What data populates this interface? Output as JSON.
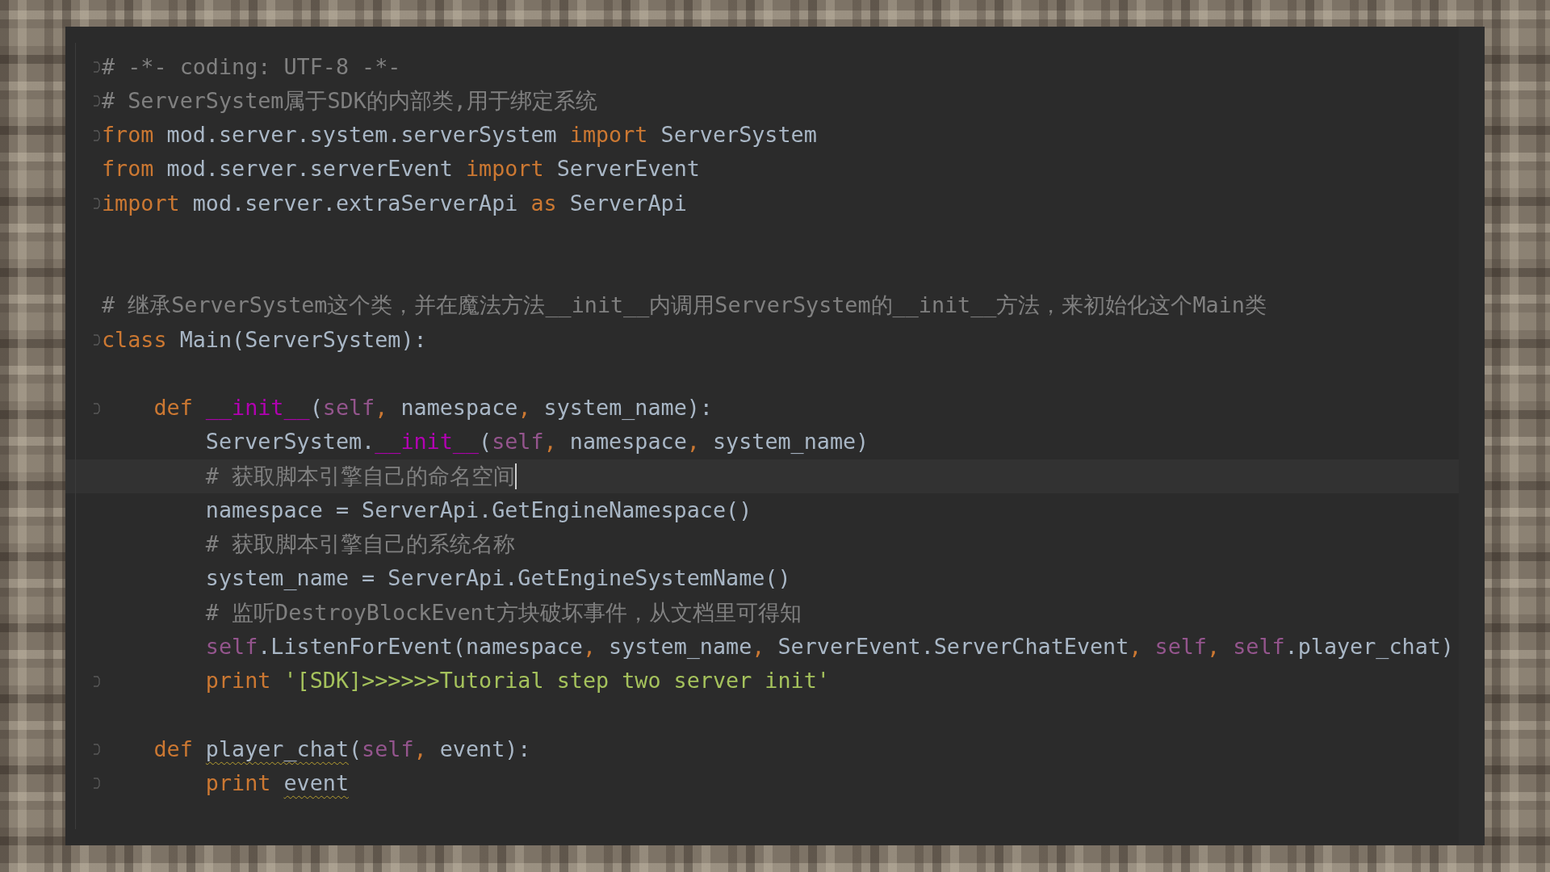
{
  "editor": {
    "lines": [
      {
        "kind": "code",
        "fold": true,
        "current": false,
        "tokens": [
          {
            "t": "# -*- coding: UTF-8 -*-",
            "kind": "comment"
          }
        ]
      },
      {
        "kind": "code",
        "fold": true,
        "current": false,
        "tokens": [
          {
            "t": "# ServerSystem属于SDK的内部类,用于绑定系统",
            "kind": "comment"
          }
        ]
      },
      {
        "kind": "code",
        "fold": true,
        "current": false,
        "tokens": [
          {
            "t": "from",
            "kind": "keyword"
          },
          {
            "t": " mod.server.system.serverSystem ",
            "kind": "plain"
          },
          {
            "t": "import",
            "kind": "keyword"
          },
          {
            "t": " ServerSystem",
            "kind": "plain"
          }
        ]
      },
      {
        "kind": "code",
        "fold": false,
        "current": false,
        "tokens": [
          {
            "t": "from",
            "kind": "keyword"
          },
          {
            "t": " mod.server.serverEvent ",
            "kind": "plain"
          },
          {
            "t": "import",
            "kind": "keyword"
          },
          {
            "t": " ServerEvent",
            "kind": "plain"
          }
        ]
      },
      {
        "kind": "code",
        "fold": true,
        "current": false,
        "tokens": [
          {
            "t": "import",
            "kind": "keyword"
          },
          {
            "t": " mod.server.extraServerApi ",
            "kind": "plain"
          },
          {
            "t": "as",
            "kind": "keyword"
          },
          {
            "t": " ServerApi",
            "kind": "plain"
          }
        ]
      },
      {
        "kind": "blank"
      },
      {
        "kind": "blank"
      },
      {
        "kind": "code",
        "fold": false,
        "current": false,
        "tokens": [
          {
            "t": "# 继承ServerSystem这个类，并在魔法方法__init__内调用ServerSystem的__init__方法，来初始化这个Main类",
            "kind": "comment"
          }
        ]
      },
      {
        "kind": "code",
        "fold": true,
        "current": false,
        "tokens": [
          {
            "t": "class",
            "kind": "keyword"
          },
          {
            "t": " Main(ServerSystem):",
            "kind": "plain"
          }
        ]
      },
      {
        "kind": "blank"
      },
      {
        "kind": "code",
        "fold": true,
        "current": false,
        "tokens": [
          {
            "t": "    def ",
            "kind": "keyword"
          },
          {
            "t": "__init__",
            "kind": "magic"
          },
          {
            "t": "(",
            "kind": "plain"
          },
          {
            "t": "self",
            "kind": "self"
          },
          {
            "t": ",",
            "kind": "keyword"
          },
          {
            "t": " namespace",
            "kind": "plain"
          },
          {
            "t": ",",
            "kind": "keyword"
          },
          {
            "t": " system_name):",
            "kind": "plain"
          }
        ]
      },
      {
        "kind": "code",
        "fold": false,
        "current": false,
        "tokens": [
          {
            "t": "        ServerSystem.",
            "kind": "plain"
          },
          {
            "t": "__init__",
            "kind": "magic"
          },
          {
            "t": "(",
            "kind": "plain"
          },
          {
            "t": "self",
            "kind": "self"
          },
          {
            "t": ",",
            "kind": "keyword"
          },
          {
            "t": " namespace",
            "kind": "plain"
          },
          {
            "t": ",",
            "kind": "keyword"
          },
          {
            "t": " system_name)",
            "kind": "plain"
          }
        ]
      },
      {
        "kind": "code",
        "fold": false,
        "current": true,
        "tokens": [
          {
            "t": "        # 获取脚本引擎自己的命名空间",
            "kind": "comment"
          }
        ]
      },
      {
        "kind": "code",
        "fold": false,
        "current": false,
        "tokens": [
          {
            "t": "        namespace = ServerApi.GetEngineNamespace()",
            "kind": "plain"
          }
        ]
      },
      {
        "kind": "code",
        "fold": false,
        "current": false,
        "tokens": [
          {
            "t": "        # 获取脚本引擎自己的系统名称",
            "kind": "comment"
          }
        ]
      },
      {
        "kind": "code",
        "fold": false,
        "current": false,
        "tokens": [
          {
            "t": "        system_name = ServerApi.GetEngineSystemName()",
            "kind": "plain"
          }
        ]
      },
      {
        "kind": "code",
        "fold": false,
        "current": false,
        "tokens": [
          {
            "t": "        # 监听DestroyBlockEvent方块破坏事件，从文档里可得知",
            "kind": "comment"
          }
        ]
      },
      {
        "kind": "code",
        "fold": false,
        "current": false,
        "tokens": [
          {
            "t": "        self",
            "kind": "self"
          },
          {
            "t": ".ListenForEvent(namespace",
            "kind": "plain"
          },
          {
            "t": ",",
            "kind": "keyword"
          },
          {
            "t": " system_name",
            "kind": "plain"
          },
          {
            "t": ",",
            "kind": "keyword"
          },
          {
            "t": " ServerEvent.ServerChatEvent",
            "kind": "plain"
          },
          {
            "t": ",",
            "kind": "keyword"
          },
          {
            "t": " self",
            "kind": "self"
          },
          {
            "t": ",",
            "kind": "keyword"
          },
          {
            "t": " self",
            "kind": "self"
          },
          {
            "t": ".player_chat)",
            "kind": "plain"
          }
        ]
      },
      {
        "kind": "code",
        "fold": true,
        "current": false,
        "tokens": [
          {
            "t": "        print ",
            "kind": "keyword"
          },
          {
            "t": "'[SDK]>>>>>>Tutorial step two server init'",
            "kind": "string"
          }
        ]
      },
      {
        "kind": "blank"
      },
      {
        "kind": "code",
        "fold": true,
        "current": false,
        "tokens": [
          {
            "t": "    def ",
            "kind": "keyword"
          },
          {
            "t": "player_chat",
            "kind": "warning"
          },
          {
            "t": "(",
            "kind": "plain"
          },
          {
            "t": "self",
            "kind": "self"
          },
          {
            "t": ",",
            "kind": "keyword"
          },
          {
            "t": " event):",
            "kind": "plain"
          }
        ]
      },
      {
        "kind": "code",
        "fold": true,
        "current": false,
        "tokens": [
          {
            "t": "        print ",
            "kind": "keyword"
          },
          {
            "t": "event",
            "kind": "warning"
          }
        ]
      }
    ]
  }
}
